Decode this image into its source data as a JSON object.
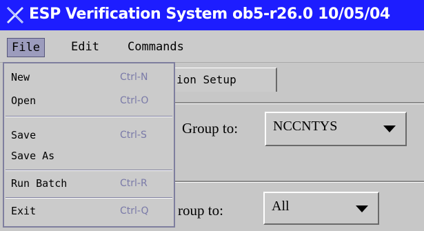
{
  "window": {
    "title": "ESP Verification System ob5-r26.0 10/05/04",
    "icon": "x-logo-icon"
  },
  "menubar": {
    "file": "File",
    "edit": "Edit",
    "commands": "Commands"
  },
  "tab": {
    "label": "ion Setup"
  },
  "content": {
    "group1_label": "Group to:",
    "group1_value": "NCCNTYS",
    "group2_label": "roup to:",
    "group2_value": "All"
  },
  "file_menu": {
    "items": [
      {
        "label": "New",
        "accel": "Ctrl-N"
      },
      {
        "label": "Open",
        "accel": "Ctrl-O"
      },
      {
        "label": "Save",
        "accel": "Ctrl-S"
      },
      {
        "label": "Save As",
        "accel": ""
      },
      {
        "label": "Run Batch",
        "accel": "Ctrl-R"
      },
      {
        "label": "Exit",
        "accel": "Ctrl-Q"
      }
    ]
  },
  "colors": {
    "titlebar": "#1d1dff",
    "menu_highlight": "#9c9cbd",
    "accel_text": "#7a7aa8"
  }
}
